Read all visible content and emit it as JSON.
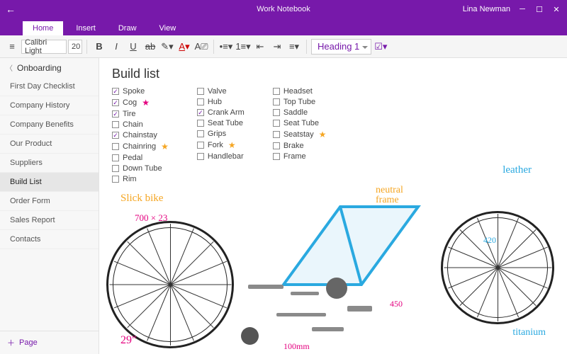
{
  "titlebar": {
    "title": "Work Notebook",
    "user": "Lina Newman"
  },
  "ribbon": {
    "tabs": [
      "Home",
      "Insert",
      "Draw",
      "View"
    ],
    "active": 0
  },
  "toolbar": {
    "font": "Calibri Light",
    "size": "20",
    "heading": "Heading 1"
  },
  "sidebar": {
    "section": "Onboarding",
    "pages": [
      "First Day Checklist",
      "Company History",
      "Company Benefits",
      "Our Product",
      "Suppliers",
      "Build List",
      "Order Form",
      "Sales Report",
      "Contacts"
    ],
    "selected": 5,
    "addPage": "Page"
  },
  "page": {
    "title": "Build list"
  },
  "checklist": {
    "col1": [
      {
        "label": "Spoke",
        "checked": true,
        "star": null
      },
      {
        "label": "Cog",
        "checked": true,
        "star": "pink"
      },
      {
        "label": "Tire",
        "checked": true,
        "star": null
      },
      {
        "label": "Chain",
        "checked": false,
        "star": null
      },
      {
        "label": "Chainstay",
        "checked": true,
        "star": null
      },
      {
        "label": "Chainring",
        "checked": false,
        "star": "orange"
      },
      {
        "label": "Pedal",
        "checked": false,
        "star": null
      },
      {
        "label": "Down Tube",
        "checked": false,
        "star": null
      },
      {
        "label": "Rim",
        "checked": false,
        "star": null
      }
    ],
    "col2": [
      {
        "label": "Valve",
        "checked": false,
        "star": null
      },
      {
        "label": "Hub",
        "checked": false,
        "star": null
      },
      {
        "label": "Crank Arm",
        "checked": true,
        "star": null
      },
      {
        "label": "Seat Tube",
        "checked": false,
        "star": null
      },
      {
        "label": "Grips",
        "checked": false,
        "star": null
      },
      {
        "label": "Fork",
        "checked": false,
        "star": "orange"
      },
      {
        "label": "Handlebar",
        "checked": false,
        "star": null
      }
    ],
    "col3": [
      {
        "label": "Headset",
        "checked": false,
        "star": null
      },
      {
        "label": "Top Tube",
        "checked": false,
        "star": null
      },
      {
        "label": "Saddle",
        "checked": false,
        "star": null
      },
      {
        "label": "Seat Tube",
        "checked": false,
        "star": null
      },
      {
        "label": "Seatstay",
        "checked": false,
        "star": "orange"
      },
      {
        "label": "Brake",
        "checked": false,
        "star": null
      },
      {
        "label": "Frame",
        "checked": false,
        "star": null
      }
    ]
  },
  "annotations": {
    "slick_bike": "Slick bike",
    "neutral_frame": "neutral\nframe",
    "leather": "leather",
    "titanium": "titanium",
    "dim_700x23": "700 × 23",
    "dim_29": "29\"",
    "dim_100mm": "100mm",
    "dim_450": "450",
    "dim_420": "420"
  }
}
